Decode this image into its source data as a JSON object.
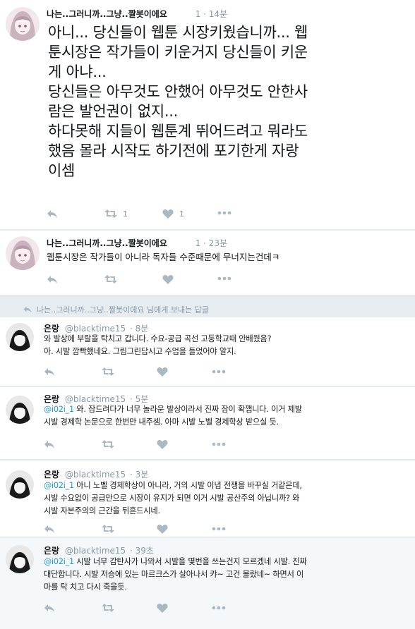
{
  "tweets": [
    {
      "author_name": "나는..그러니까..그냥..짤봇이에요",
      "time": "1 · 14분",
      "body": "아니... 당신들이 웹툰 시장키웠습니까... 웹\n툰시장은 작가들이 키운거지 당신들이 키운\n게 아냐...\n당신들은 아무것도 안했어 아무것도 안한사\n람은 발언권이 없지...\n하다못해 지들이 웹툰계 뛰어드려고 뭐라도\n했음 몰라 시작도 하기전에 포기한게 자랑\n이셈",
      "retweet_count": "1",
      "like_count": "1"
    },
    {
      "author_name": "나는..그러니까..그냥..짤봇이에요",
      "time": "1 · 23분",
      "body": "웹툰시장은 작가들이 아니라 독자들 수준때문에 무너지는건데ㅋ",
      "retweet_count": "",
      "like_count": ""
    }
  ],
  "reply_context": {
    "text": "나는..그러니까..그냥..짤봇이에요 님에게 보내는 답글"
  },
  "replies": [
    {
      "author_name": "은랑",
      "handle": "@blacktime15",
      "time": "· 8분",
      "mention": "",
      "body": "와 발상에 부랄을 탁치고 갑니다. 수요-공급 곡선 고등학교때 안배웠음?\n아. 시발 깜빡했네요. 그림그린답시고 수업을 들었어야 알지."
    },
    {
      "author_name": "은랑",
      "handle": "@blacktime15",
      "time": "· 5분",
      "mention": "@i02i_1",
      "body": " 와. 잠드려다가 너무 놀라운 발상이라서 진짜 잠이 확깹니다. 이거 제발\n시발 경제학 논문으로 한번만 내주셈. 아마 시발 노벨 경제학상 받으실 듯."
    },
    {
      "author_name": "은랑",
      "handle": "@blacktime15",
      "time": "· 3분",
      "mention": "@i02i_1",
      "body": " 아니 노벨 경제학상이 아니라, 거의 시발 이념 전쟁을 바꾸실 거같은데,\n시발 수요없이 공급만으로 시장이 유지가 되면 이거 시발 공산주의 아닙니까? 와\n시발 자본주의의 근간을 뒤흔드시네."
    },
    {
      "author_name": "은랑",
      "handle": "@blacktime15",
      "time": "· 39초",
      "mention": "@i02i_1",
      "body": " 시발 너무 감탄사가 나와서 시발을 몇번을 쓰는건지 모르겠네 시발. 진짜\n대단합니다. 시발 저승에 있는 마르크스가 살아나서 캬~ 고건 몰랐네~ 하면서 이\n마를 탁 치고 다시 죽을듯."
    }
  ],
  "colors": {
    "background": "#e6ecf0",
    "card": "#ffffff",
    "highlight_card": "#f5f8fa",
    "text": "#14171a",
    "muted": "#8899a6",
    "icon": "#aab8c2",
    "mention": "#1b95e0"
  },
  "icons": [
    "reply-icon",
    "retweet-icon",
    "like-icon",
    "more-icon"
  ]
}
